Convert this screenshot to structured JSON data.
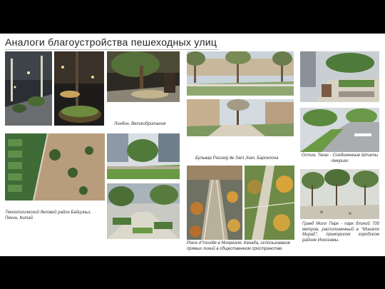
{
  "title": "Аналоги благоустройства пешеходных улиц",
  "captions": {
    "london": "Лондон, Великобритания",
    "beijing": "Технологический деловой район Байциньз, Пекин, Китай",
    "barcelona": "Бульвар Passeig de Sant Joan, Барселона",
    "montreal": "Place d'Youville в Монреале, Канада, использование прямых линий в общественном пространстве.",
    "austin": "Остин, Техас - Соединенные Штаты Америки",
    "yokohama": "Гранд Молл Парк - парк длиной 700 метров, расположенный в \"Минато Мирай\", приморском городском районе Иокогамы."
  }
}
